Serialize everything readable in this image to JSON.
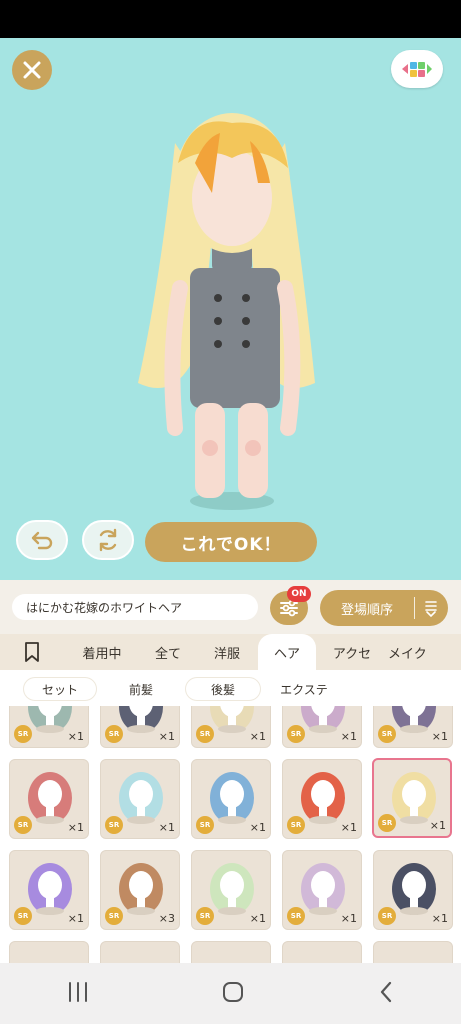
{
  "stage": {
    "ok_label": "これでOK！",
    "background_color": "#a5e4e2",
    "accent_color": "#c9a45c"
  },
  "item_info": {
    "name": "はにかむ花嫁のホワイトヘア",
    "filter_badge": "ON",
    "sort_label": "登場順序"
  },
  "category_tabs": {
    "bookmark_icon": "bookmark-icon",
    "items": [
      "着用中",
      "全て",
      "洋服",
      "ヘア",
      "アクセ",
      "メイク"
    ],
    "active": "ヘア"
  },
  "sub_tabs": {
    "items": [
      "セット",
      "前髪",
      "後髪",
      "エクステ"
    ]
  },
  "items": [
    {
      "rarity": "SR",
      "qty": "×1",
      "hair": "#8fb0a8"
    },
    {
      "rarity": "SR",
      "qty": "×1",
      "hair": "#444a63"
    },
    {
      "rarity": "SR",
      "qty": "×1",
      "hair": "#e8d9b0"
    },
    {
      "rarity": "SR",
      "qty": "×1",
      "hair": "#c5a1c9"
    },
    {
      "rarity": "SR",
      "qty": "×1",
      "hair": "#6b5e8a"
    },
    {
      "rarity": "SR",
      "qty": "×1",
      "hair": "#d46a6a"
    },
    {
      "rarity": "SR",
      "qty": "×1",
      "hair": "#a8dde6"
    },
    {
      "rarity": "SR",
      "qty": "×1",
      "hair": "#6fa8d8"
    },
    {
      "rarity": "SR",
      "qty": "×1",
      "hair": "#e24b2f"
    },
    {
      "rarity": "SR",
      "qty": "×1",
      "hair": "#f1dd9a"
    },
    {
      "rarity": "SR",
      "qty": "×1",
      "hair": "#9b7be0"
    },
    {
      "rarity": "SR",
      "qty": "×3",
      "hair": "#b87a4e"
    },
    {
      "rarity": "SR",
      "qty": "×1",
      "hair": "#c9e6b8"
    },
    {
      "rarity": "SR",
      "qty": "×1",
      "hair": "#cdb2d8"
    },
    {
      "rarity": "SR",
      "qty": "×1",
      "hair": "#2f3650"
    }
  ],
  "selected_item": 9,
  "nav": {
    "recent_icon": "recent-apps-icon",
    "home_icon": "home-icon",
    "back_icon": "back-icon"
  }
}
